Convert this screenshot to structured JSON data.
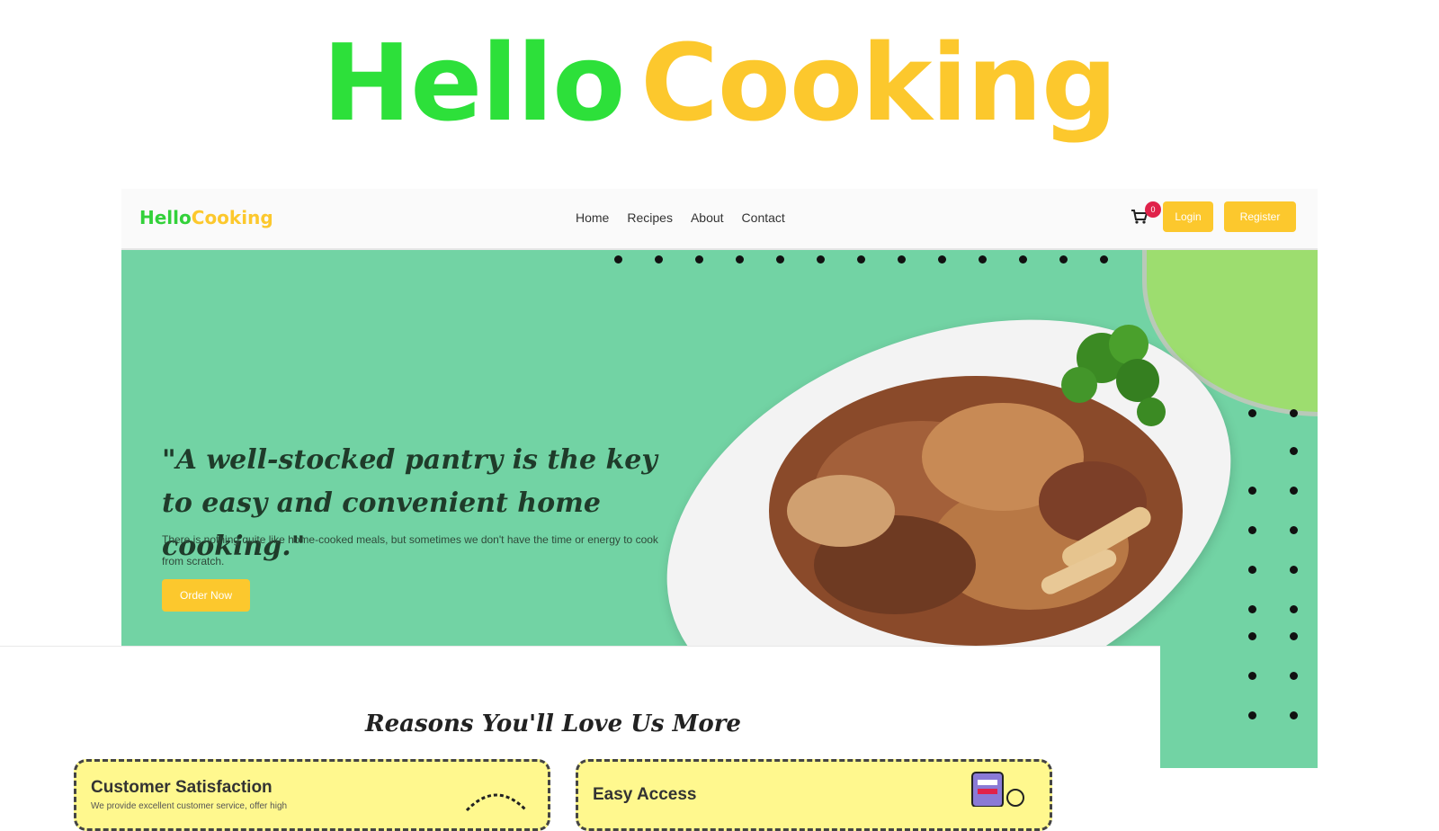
{
  "banner": {
    "title_part1": "Hello",
    "title_part2": "Cooking"
  },
  "navbar": {
    "logo_part1": "Hello",
    "logo_part2": "Cooking",
    "links": [
      "Home",
      "Recipes",
      "About",
      "Contact"
    ],
    "cart_count": "0",
    "login_label": "Login",
    "register_label": "Register"
  },
  "hero": {
    "quote": "\"A well-stocked pantry is the key to easy and convenient home cooking.\"",
    "text": "There is nothing quite like home-cooked meals, but sometimes we don't have the time or energy to cook from scratch.",
    "cta_label": "Order Now"
  },
  "reasons": {
    "heading": "Reasons You'll Love Us More",
    "cards": [
      {
        "title": "Customer Satisfaction",
        "desc": "We provide excellent customer service, offer high"
      },
      {
        "title": "Easy Access",
        "desc": ""
      }
    ]
  },
  "colors": {
    "brand_green": "#2de03a",
    "brand_yellow": "#fcc82d",
    "hero_bg": "#72d3a4",
    "card_bg": "#fff88e",
    "badge_red": "#e0224a"
  },
  "icons": [
    "cart-icon",
    "food-plate-image",
    "parsley-icon",
    "pizza-icon",
    "phone-order-icon"
  ]
}
